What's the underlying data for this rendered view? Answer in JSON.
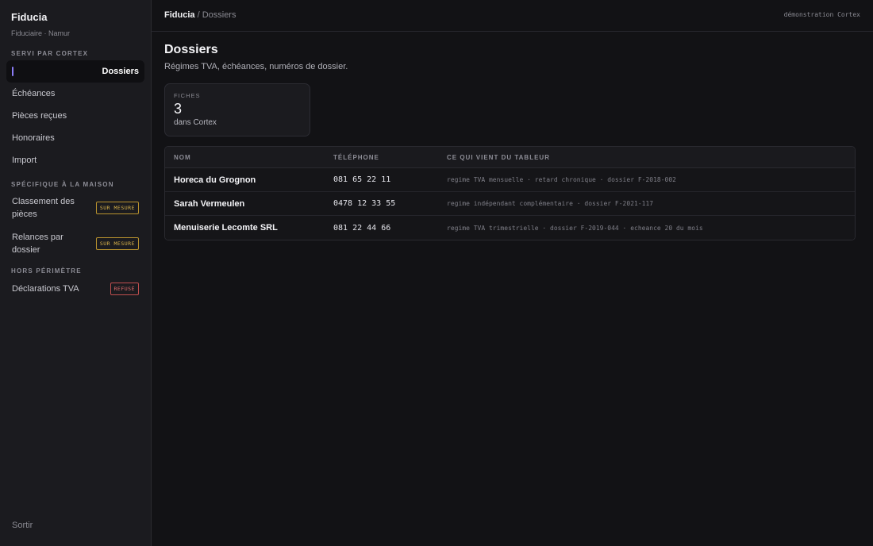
{
  "brand": {
    "name": "Fiducia",
    "subtitle": "Fiduciaire · Namur"
  },
  "sidebar": {
    "sections": [
      {
        "title": "SERVI PAR CORTEX"
      },
      {
        "title": "SPÉCIFIQUE À LA MAISON"
      },
      {
        "title": "HORS PÉRIMÈTRE"
      }
    ],
    "items": [
      {
        "label": "Dossiers",
        "active": true
      },
      {
        "label": "Échéances"
      },
      {
        "label": "Pièces reçues"
      },
      {
        "label": "Honoraires"
      },
      {
        "label": "Import"
      },
      {
        "label": "Classement des pièces",
        "badge": "SUR MESURE"
      },
      {
        "label": "Relances par dossier",
        "badge": "SUR MESURE"
      },
      {
        "label": "Déclarations TVA",
        "badge": "REFUSÉ"
      }
    ],
    "logout": "Sortir"
  },
  "topbar": {
    "breadcrumb_home": "Fiducia",
    "breadcrumb_sep": " / ",
    "breadcrumb_current": "Dossiers",
    "demo_label": "démonstration Cortex"
  },
  "page": {
    "title": "Dossiers",
    "subtitle": "Régimes TVA, échéances, numéros de dossier."
  },
  "stat": {
    "label": "FICHES",
    "value": "3",
    "note": "dans Cortex"
  },
  "table": {
    "headers": [
      "NOM",
      "TÉLÉPHONE",
      "CE QUI VIENT DU TABLEUR"
    ],
    "rows": [
      {
        "name": "Horeca du Grognon",
        "phone": "081 65 22 11",
        "info": "regime TVA mensuelle · retard chronique · dossier F-2018-002"
      },
      {
        "name": "Sarah Vermeulen",
        "phone": "0478 12 33 55",
        "info": "regime indépendant complémentaire · dossier F-2021-117"
      },
      {
        "name": "Menuiserie Lecomte SRL",
        "phone": "081 22 44 66",
        "info": "regime TVA trimestrielle · dossier F-2019-044 · echeance 20 du mois"
      }
    ]
  },
  "colors": {
    "accent": "#8b7cf6",
    "custom_badge": "#d8b24a",
    "refused_badge": "#e06b6b"
  }
}
